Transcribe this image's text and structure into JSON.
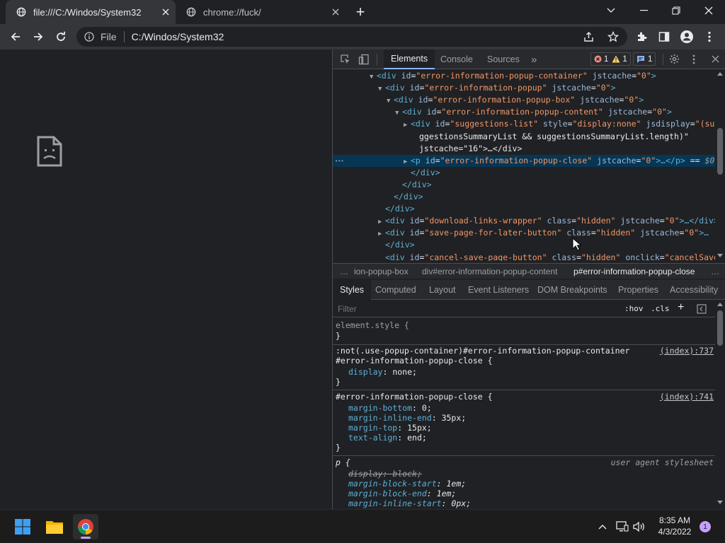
{
  "browser": {
    "tabs": [
      {
        "title": "file:///C:/Windos/System32",
        "active": true
      },
      {
        "title": "chrome://fuck/",
        "active": false
      }
    ],
    "new_tab_label": "+",
    "omnibox": {
      "scheme_label": "File",
      "url": "C:/Windos/System32"
    }
  },
  "devtools": {
    "main_tabs": [
      "Elements",
      "Console",
      "Sources"
    ],
    "more_tabs": "»",
    "badges": {
      "errors": "1",
      "warnings": "1",
      "messages": "1"
    },
    "dom": [
      {
        "arrow": "▼",
        "indent": 5,
        "tag": "div",
        "attrs": [
          [
            "id",
            "error-information-popup-container"
          ],
          [
            "jstcache",
            "0"
          ]
        ],
        "suffix": ">"
      },
      {
        "arrow": "▼",
        "indent": 6,
        "tag": "div",
        "attrs": [
          [
            "id",
            "error-information-popup"
          ],
          [
            "jstcache",
            "0"
          ]
        ],
        "suffix": ">"
      },
      {
        "arrow": "▼",
        "indent": 7,
        "tag": "div",
        "attrs": [
          [
            "id",
            "error-information-popup-box"
          ],
          [
            "jstcache",
            "0"
          ]
        ],
        "suffix": ">"
      },
      {
        "arrow": "▼",
        "indent": 8,
        "tag": "div",
        "attrs": [
          [
            "id",
            "error-information-popup-content"
          ],
          [
            "jstcache",
            "0"
          ]
        ],
        "suffix": ">"
      },
      {
        "arrow": "▶",
        "indent": 9,
        "tag": "div",
        "attrs": [
          [
            "id",
            "suggestions-list"
          ],
          [
            "style",
            "display:none"
          ],
          [
            "jsdisplay",
            "(su"
          ]
        ],
        "suffix": ""
      },
      {
        "arrow": "",
        "indent": 10,
        "raw": "ggestionsSummaryList && suggestionsSummaryList.length)\""
      },
      {
        "arrow": "",
        "indent": 10,
        "raw": "jstcache=\"16\">…</div>"
      },
      {
        "arrow": "▶",
        "indent": 9,
        "tag": "p",
        "attrs": [
          [
            "id",
            "error-information-popup-close"
          ],
          [
            "jstcache",
            "0"
          ]
        ],
        "suffix": ">…</p> == $0",
        "selected": true
      },
      {
        "arrow": "",
        "indent": 9,
        "raw": "</div>"
      },
      {
        "arrow": "",
        "indent": 8,
        "raw": "</div>"
      },
      {
        "arrow": "",
        "indent": 7,
        "raw": "</div>"
      },
      {
        "arrow": "",
        "indent": 6,
        "raw": "</div>"
      },
      {
        "arrow": "▶",
        "indent": 6,
        "tag": "div",
        "attrs": [
          [
            "id",
            "download-links-wrapper"
          ],
          [
            "class",
            "hidden"
          ],
          [
            "jstcache",
            "0"
          ]
        ],
        "suffix": ">…</div>"
      },
      {
        "arrow": "▶",
        "indent": 6,
        "tag": "div",
        "attrs": [
          [
            "id",
            "save-page-for-later-button"
          ],
          [
            "class",
            "hidden"
          ],
          [
            "jstcache",
            "0"
          ]
        ],
        "suffix": ">…"
      },
      {
        "arrow": "",
        "indent": 6,
        "raw": "</div>"
      },
      {
        "arrow": "",
        "indent": 6,
        "tag": "div",
        "attrs": [
          [
            "id",
            "cancel-save-page-button"
          ],
          [
            "class",
            "hidden"
          ],
          [
            "onclick",
            "cancelSavePa"
          ]
        ],
        "suffix": ""
      }
    ],
    "breadcrumbs": [
      "…",
      "ion-popup-box",
      "div#error-information-popup-content",
      "p#error-information-popup-close",
      "…"
    ],
    "styles_tabs": [
      "Styles",
      "Computed",
      "Layout",
      "Event Listeners",
      "DOM Breakpoints",
      "Properties",
      "Accessibility"
    ],
    "filter_placeholder": "Filter",
    "filter_tools": [
      ":hov",
      ".cls",
      "+"
    ],
    "rules": [
      {
        "selector": "element.style {",
        "props": [],
        "close": "}",
        "source": ""
      },
      {
        "selector": ":not(.use-popup-container)#error-information-popup-container",
        "selector2": "#error-information-popup-close {",
        "props": [
          [
            "display",
            "none;"
          ]
        ],
        "close": "}",
        "source": "(index):737"
      },
      {
        "selector": "#error-information-popup-close {",
        "props": [
          [
            "margin-bottom",
            "0;"
          ],
          [
            "margin-inline-end",
            "35px;"
          ],
          [
            "margin-top",
            "15px;"
          ],
          [
            "text-align",
            "end;"
          ]
        ],
        "close": "}",
        "source": "(index):741"
      },
      {
        "selector": "p {",
        "props": [
          [
            "display",
            "block;"
          ],
          [
            "margin-block-start",
            "1em;"
          ],
          [
            "margin-block-end",
            "1em;"
          ],
          [
            "margin-inline-start",
            "0px;"
          ]
        ],
        "close": "",
        "source": "user agent stylesheet"
      }
    ]
  },
  "taskbar": {
    "time": "8:35 AM",
    "date": "4/3/2022",
    "notification_count": "1"
  },
  "colors": {
    "bg": "#202124",
    "toolbar": "#35363a",
    "selection": "#073655",
    "accent": "#8ab4f8"
  }
}
